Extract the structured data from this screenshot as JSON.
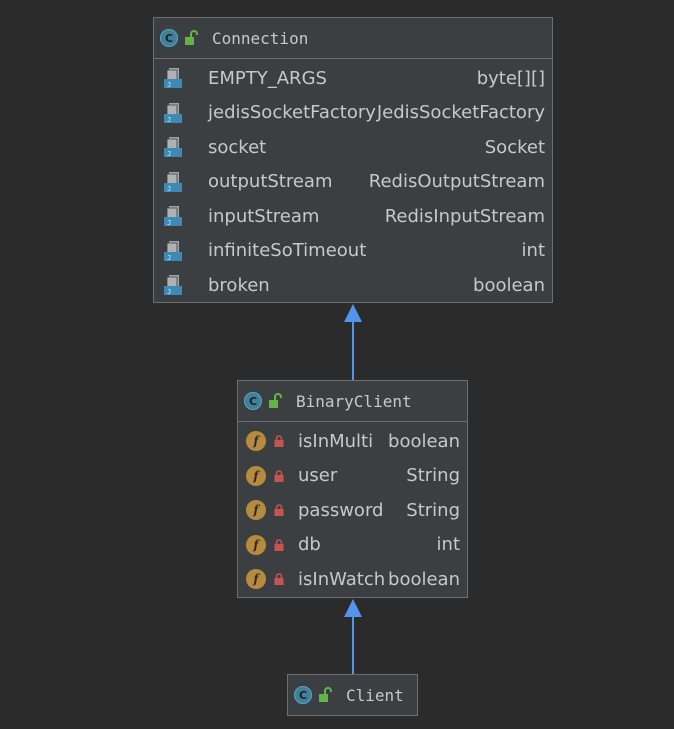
{
  "classes": {
    "connection": {
      "name": "Connection",
      "fields": [
        {
          "name": "EMPTY_ARGS",
          "type": "byte[][]"
        },
        {
          "name": "jedisSocketFactory",
          "type": "JedisSocketFactory"
        },
        {
          "name": "socket",
          "type": "Socket"
        },
        {
          "name": "outputStream",
          "type": "RedisOutputStream"
        },
        {
          "name": "inputStream",
          "type": "RedisInputStream"
        },
        {
          "name": "infiniteSoTimeout",
          "type": "int"
        },
        {
          "name": "broken",
          "type": "boolean"
        }
      ]
    },
    "binary_client": {
      "name": "BinaryClient",
      "fields": [
        {
          "name": "isInMulti",
          "type": "boolean"
        },
        {
          "name": "user",
          "type": "String"
        },
        {
          "name": "password",
          "type": "String"
        },
        {
          "name": "db",
          "type": "int"
        },
        {
          "name": "isInWatch",
          "type": "boolean"
        }
      ]
    },
    "client": {
      "name": "Client"
    }
  },
  "icons": {
    "class_badge": "C",
    "field_badge": "f"
  },
  "colors": {
    "background": "#2b2b2b",
    "box": "#3c3f41",
    "arrow": "#5394ec",
    "class_icon": "#40809b",
    "field_icon": "#b78b3e",
    "lock": "#c75450",
    "unlock": "#62b543"
  }
}
